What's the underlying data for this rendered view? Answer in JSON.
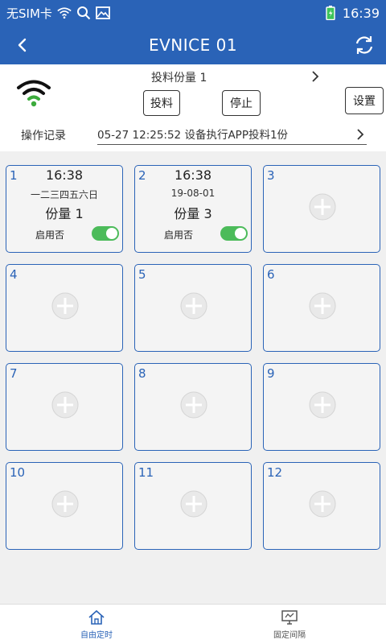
{
  "status": {
    "sim": "无SIM卡",
    "time": "16:39"
  },
  "appbar": {
    "title": "EVNICE 01"
  },
  "panel": {
    "feed_title": "投料份量 1",
    "feed_button": "投料",
    "stop_button": "停止",
    "settings_button": "设置",
    "log_label": "操作记录",
    "log_text": "05-27 12:25:52 设备执行APP投料1份"
  },
  "slots": [
    {
      "num": "1",
      "time": "16:38",
      "days": "一二三四五六日",
      "qty": "份量 1",
      "enable_label": "启用否",
      "enabled": true
    },
    {
      "num": "2",
      "time": "16:38",
      "days": "19-08-01",
      "qty": "份量 3",
      "enable_label": "启用否",
      "enabled": true
    },
    {
      "num": "3"
    },
    {
      "num": "4"
    },
    {
      "num": "5"
    },
    {
      "num": "6"
    },
    {
      "num": "7"
    },
    {
      "num": "8"
    },
    {
      "num": "9"
    },
    {
      "num": "10"
    },
    {
      "num": "11"
    },
    {
      "num": "12"
    }
  ],
  "tabs": {
    "auto": "自由定时",
    "fixed": "固定间隔"
  },
  "colors": {
    "primary": "#2a63b7",
    "toggle_on": "#4cbb5a",
    "wifi_green": "#3cab3c"
  },
  "icons": [
    "wifi-icon",
    "search-icon",
    "image-icon",
    "battery-icon",
    "back-icon",
    "refresh-icon",
    "chevron-right-icon",
    "plus-icon",
    "home-icon",
    "monitor-icon"
  ]
}
